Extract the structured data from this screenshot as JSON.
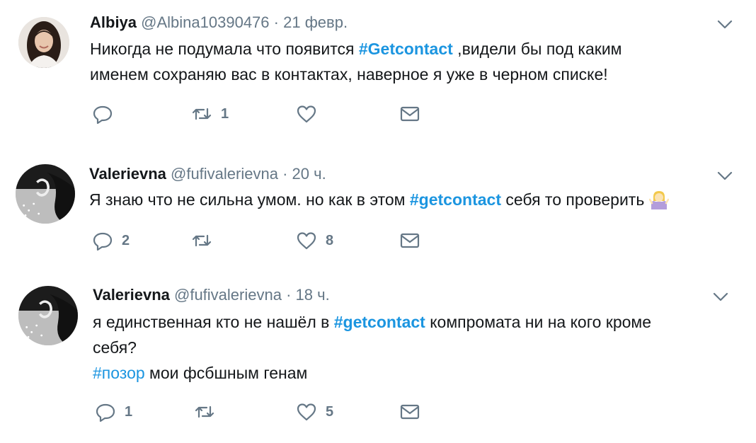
{
  "tweets": [
    {
      "name": "Albiya",
      "handle": "@Albina10390476",
      "dot": "·",
      "time": "21 февр.",
      "lines": [
        {
          "pre": "Никогда не подумала что появится ",
          "tag": "#Getcontact",
          "post": " ,видели бы под каким"
        },
        {
          "pre": "именем  сохраняю вас в контактах, наверное  я уже в черном списке!",
          "tag": "",
          "post": ""
        }
      ],
      "counts": {
        "reply": "",
        "retweet": "1",
        "like": ""
      }
    },
    {
      "name": "Valerievna",
      "handle": "@fufivalerievna",
      "dot": "·",
      "time": "20 ч.",
      "lines": [
        {
          "pre": "Я знаю что не сильна умом. но как в этом ",
          "tag": "#getcontact",
          "post": " себя то проверить "
        }
      ],
      "counts": {
        "reply": "2",
        "retweet": "",
        "like": "8"
      }
    },
    {
      "name": "Valerievna",
      "handle": "@fufivalerievna",
      "dot": "·",
      "time": "18 ч.",
      "lines": [
        {
          "pre": "я единственная кто не нашёл в ",
          "tag": "#getcontact",
          "post": " компромата ни на кого кроме"
        },
        {
          "pre": "себя?",
          "tag": "",
          "post": ""
        }
      ],
      "hashtag_line": {
        "tag": "#позор",
        "post": " мои фсбшным генам"
      },
      "counts": {
        "reply": "1",
        "retweet": "",
        "like": "5"
      }
    }
  ],
  "icons": {
    "reply": "reply-icon",
    "retweet": "retweet-icon",
    "like": "heart-icon",
    "dm": "envelope-icon",
    "more": "chevron-down-icon",
    "emoji": "woman-shrugging-emoji"
  },
  "colors": {
    "link": "#1b95e0",
    "muted": "#657786",
    "text": "#14171a"
  }
}
